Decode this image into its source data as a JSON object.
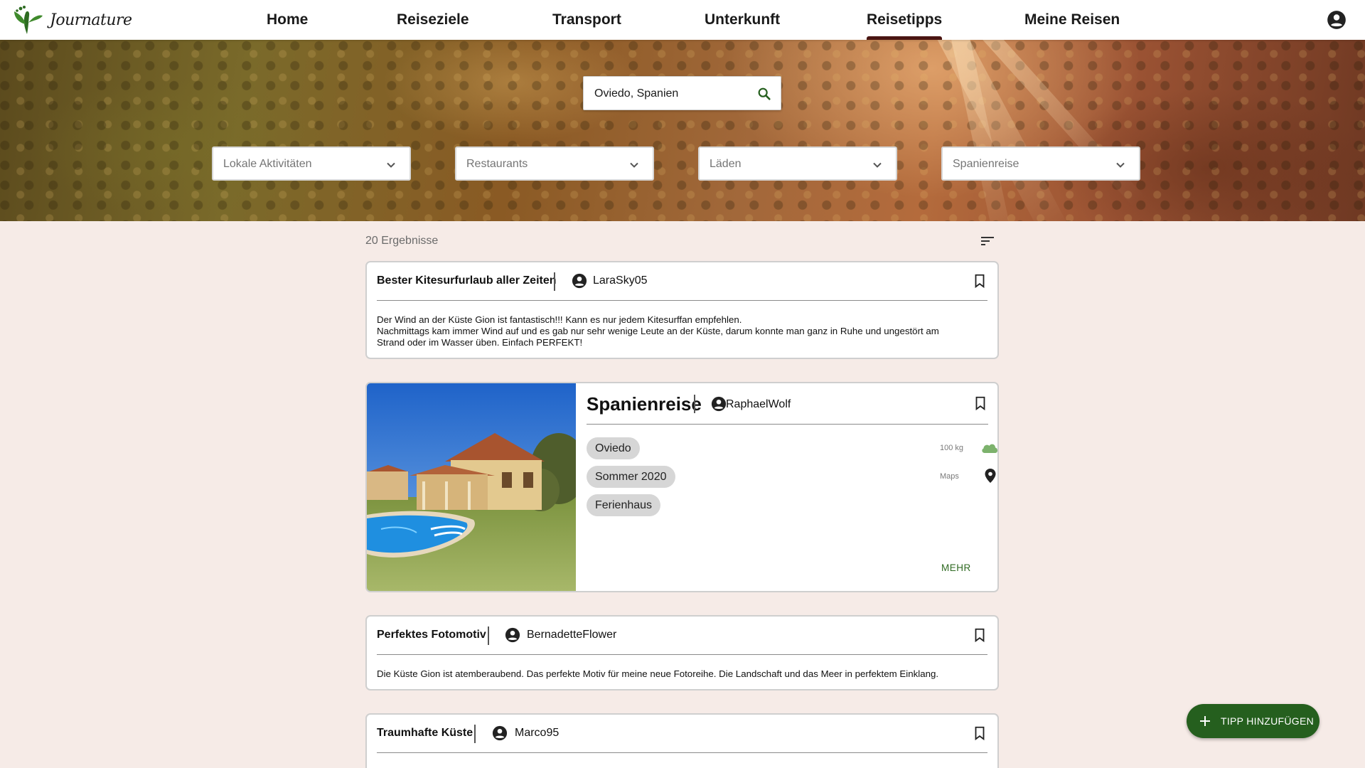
{
  "app": {
    "logo_text": "Journature"
  },
  "nav": {
    "items": [
      {
        "label": "Home"
      },
      {
        "label": "Reiseziele"
      },
      {
        "label": "Transport"
      },
      {
        "label": "Unterkunft"
      },
      {
        "label": "Reisetipps",
        "active": true
      },
      {
        "label": "Meine Reisen"
      }
    ]
  },
  "search": {
    "value": "Oviedo, Spanien"
  },
  "filters": [
    {
      "label": "Lokale Aktivitäten"
    },
    {
      "label": "Restaurants"
    },
    {
      "label": "Läden"
    },
    {
      "label": "Spanienreise"
    }
  ],
  "results": {
    "count_label": "20 Ergebnisse"
  },
  "cards": [
    {
      "title": "Bester Kitesurfurlaub aller Zeiten",
      "user": "LaraSky05",
      "text": [
        "Der Wind an der Küste Gion ist fantastisch!!! Kann es nur jedem Kitesurffan empfehlen.",
        "Nachmittags kam immer Wind auf und es gab nur sehr wenige Leute an der Küste, darum konnte man ganz in Ruhe und ungestört am",
        "Strand oder im Wasser üben. Einfach PERFEKT!"
      ]
    },
    {
      "title": "Spanienreise",
      "user": "RaphaelWolf",
      "chips": [
        "Oviedo",
        "Sommer 2020",
        "Ferienhaus"
      ],
      "co2_label": "100 kg",
      "maps_label": "Maps",
      "more_label": "MEHR"
    },
    {
      "title": "Perfektes Fotomotiv",
      "user": "BernadetteFlower",
      "text": [
        "Die Küste Gion ist atemberaubend. Das perfekte Motiv für meine neue Fotoreihe. Die Landschaft und das Meer in perfektem Einklang."
      ]
    },
    {
      "title": "Traumhafte Küste",
      "user": "Marco95"
    }
  ],
  "fab": {
    "label": "TIPP HINZUFÜGEN"
  },
  "colors": {
    "accent_green": "#255f1e",
    "active_tab": "#4a1512",
    "background": "#f6ebe7"
  }
}
